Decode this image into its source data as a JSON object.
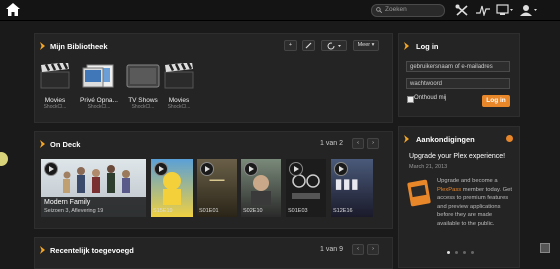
{
  "search": {
    "placeholder": "Zoeken"
  },
  "library": {
    "title": "Mijn Bibliotheek",
    "more_label": "Meer",
    "items": [
      {
        "title": "Movies",
        "server": "ShockCl..."
      },
      {
        "title": "Privé Opna...",
        "server": "ShockCl..."
      },
      {
        "title": "TV Shows",
        "server": "ShockCl..."
      },
      {
        "title": "Movies",
        "server": "ShockCl..."
      }
    ]
  },
  "ondeck": {
    "title": "On Deck",
    "pager": "1 van 2",
    "featured": {
      "title": "Modern Family",
      "subtitle": "Seizoen 3, Aflevering 19"
    },
    "episodes": [
      "S15E19",
      "S01E01",
      "S02E10",
      "S01E03",
      "S12E16"
    ]
  },
  "recent": {
    "title": "Recentelijk toegevoegd",
    "pager": "1 van 9"
  },
  "login": {
    "title": "Log in",
    "username_placeholder": "gebruikersnaam of e-mailadres",
    "password_placeholder": "wachtwoord",
    "remember_label": "Onthoud mij",
    "submit_label": "Log in"
  },
  "news": {
    "title": "Aankondigingen",
    "headline": "Upgrade your Plex experience!",
    "date": "March 21, 2013",
    "body_pre": "Upgrade and become a",
    "link": "PlexPass",
    "body_post": "member today. Get access to premium features and preview applications before they are made available to the public.",
    "badge": "PLEX PASS"
  },
  "colors": {
    "accent": "#f5a623",
    "login_button": "#e8862a",
    "panel": "#242424"
  }
}
